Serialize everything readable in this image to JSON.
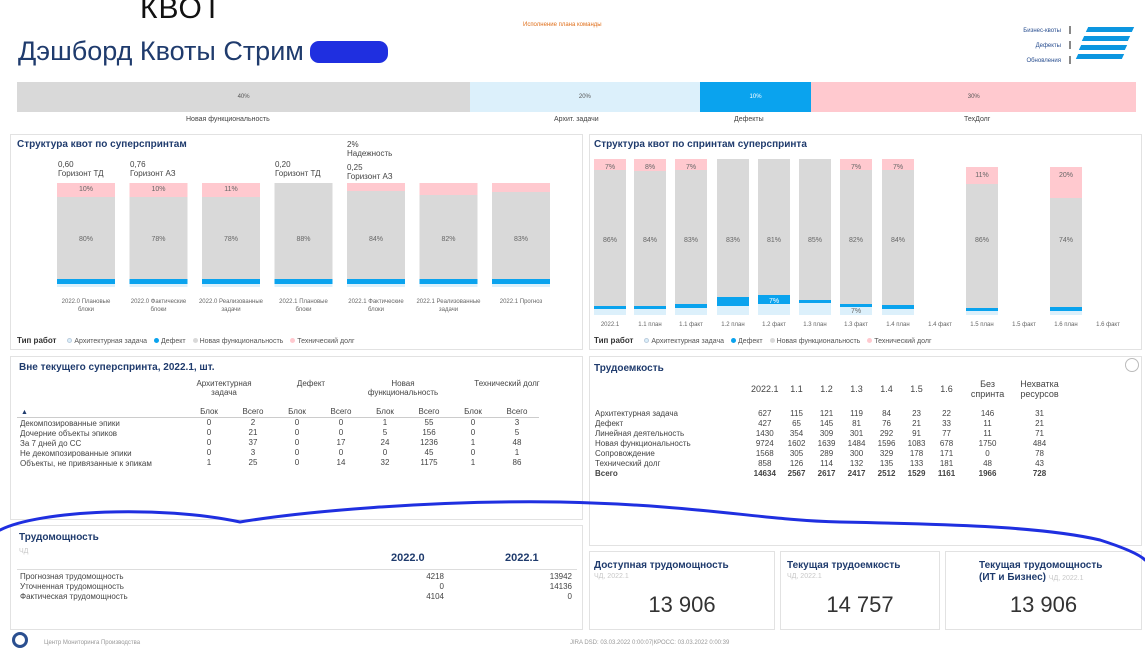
{
  "header": {
    "cut_text": "КВОТ",
    "title": "Дэшборд Квоты Стрим",
    "banner_note": "Исполнение плана команды",
    "links": [
      "Бизнес-квоты",
      "Дефекты",
      "Обновления"
    ]
  },
  "quota_bar": {
    "segments": [
      {
        "label": "Новая функциональность",
        "value": "40%",
        "color": "#d9d9d9",
        "flex": 40.5
      },
      {
        "label": "Архит. задачи",
        "value": "20%",
        "color": "#dcf0fb",
        "flex": 20.5
      },
      {
        "label": "Дефекты",
        "value": "10%",
        "color": "#0aa3ee",
        "flex": 10
      },
      {
        "label": "ТехДолг",
        "value": "30%",
        "color": "#ffc9cf",
        "flex": 29
      }
    ]
  },
  "superspring_chart": {
    "title": "Структура квот по суперспринтам",
    "annotations": [
      {
        "text": "0,60",
        "text2": "Горизонт ТД"
      },
      {
        "text": "0,76",
        "text2": "Горизонт АЗ"
      },
      {
        "text": "0,20",
        "text2": "Горизонт ТД"
      },
      {
        "text": "2%",
        "text2": "Надежность"
      },
      {
        "text": "0,25",
        "text2": "Горизонт АЗ"
      }
    ],
    "legend_title": "Тип работ",
    "legend": [
      {
        "name": "Архитектурная задача",
        "color": "#dcf0fb"
      },
      {
        "name": "Дефект",
        "color": "#0aa3ee"
      },
      {
        "name": "Новая функциональность",
        "color": "#d9d9d9"
      },
      {
        "name": "Технический долг",
        "color": "#ffc9cf"
      }
    ]
  },
  "sprint_chart": {
    "title": "Структура квот по спринтам суперспринта",
    "legend_title": "Тип работ"
  },
  "chart_data": [
    {
      "type": "bar",
      "title": "Структура квот по суперспринтам",
      "stacked": "100%",
      "categories": [
        "2022.0 Плановые блоки",
        "2022.0 Фактические блоки",
        "2022.0 Реализованные задачи",
        "2022.1 Плановые блоки",
        "2022.1 Фактические блоки",
        "2022.1 Реализованные задачи",
        "2022.1 Прогноз"
      ],
      "series": [
        {
          "name": "Новая функциональность",
          "values": [
            80,
            78,
            78,
            88,
            84,
            82,
            83
          ],
          "labels": [
            "80%",
            "78%",
            "78%",
            "88%",
            "84%",
            "82%",
            "83%"
          ]
        },
        {
          "name": "Технический долг",
          "values": [
            10,
            10,
            11,
            0,
            0,
            0,
            0
          ],
          "labels": [
            "10%",
            "10%",
            "11%",
            "",
            "",
            "",
            ""
          ]
        },
        {
          "name": "Дефект",
          "values": [
            3,
            3,
            2,
            2,
            2,
            2,
            2
          ]
        },
        {
          "name": "Архитектурная задача",
          "values": [
            7,
            9,
            9,
            10,
            14,
            16,
            15
          ]
        }
      ],
      "tp_heights": [
        14,
        14,
        14,
        0,
        8,
        12,
        9
      ]
    },
    {
      "type": "bar",
      "title": "Структура квот по спринтам суперспринта",
      "stacked": "100%",
      "categories": [
        "2022.1",
        "1.1 план",
        "1.1 факт",
        "1.2 план",
        "1.2 факт",
        "1.3 план",
        "1.3 факт",
        "1.4 план",
        "1.4 факт",
        "1.5 план",
        "1.5 факт",
        "1.6 план",
        "1.6 факт"
      ],
      "series": [
        {
          "name": "Технический долг",
          "values": [
            7,
            8,
            7,
            0,
            0,
            0,
            7,
            7,
            0,
            11,
            0,
            20,
            0
          ],
          "labels": [
            "7%",
            "8%",
            "7%",
            "",
            "",
            "",
            "7%",
            "7%",
            "",
            "11%",
            "",
            "20%",
            ""
          ]
        },
        {
          "name": "Новая функциональность",
          "values": [
            86,
            84,
            83,
            83,
            81,
            85,
            82,
            84,
            0,
            86,
            0,
            74,
            0
          ],
          "labels": [
            "86%",
            "84%",
            "83%",
            "83%",
            "81%",
            "85%",
            "82%",
            "84%",
            "",
            "86%",
            "",
            "74%",
            ""
          ]
        },
        {
          "name": "Дефект",
          "values": [
            1,
            2,
            3,
            7,
            7,
            2,
            2,
            3,
            0,
            2,
            0,
            3,
            0
          ],
          "labels": [
            "",
            "",
            "",
            "",
            "7%",
            "",
            "",
            "",
            "",
            "",
            "",
            "",
            ""
          ]
        },
        {
          "name": "Архитектурная задача",
          "values": [
            6,
            6,
            7,
            10,
            12,
            13,
            9,
            6,
            0,
            1,
            0,
            3,
            0
          ],
          "labels": [
            "",
            "",
            "",
            "",
            "",
            "",
            "7%",
            "",
            "",
            "",
            "",
            "",
            ""
          ]
        }
      ]
    }
  ],
  "out_table": {
    "title": "Вне текущего суперспринта, 2022.1, шт.",
    "groups": [
      "Архитектурная задача",
      "Дефект",
      "Новая функциональность",
      "Технический долг"
    ],
    "sub": [
      "Блок",
      "Всего"
    ],
    "rows": [
      {
        "label": "Декомпозированные эпики",
        "cells": [
          "0",
          "2",
          "0",
          "0",
          "1",
          "55",
          "0",
          "3"
        ]
      },
      {
        "label": "Дочерние объекты эпиков",
        "cells": [
          "0",
          "21",
          "0",
          "0",
          "5",
          "156",
          "0",
          "5"
        ]
      },
      {
        "label": "За 7 дней до СС",
        "cells": [
          "0",
          "37",
          "0",
          "17",
          "24",
          "1236",
          "1",
          "48"
        ]
      },
      {
        "label": "Не декомпозированные эпики",
        "cells": [
          "0",
          "3",
          "0",
          "0",
          "0",
          "45",
          "0",
          "1"
        ]
      },
      {
        "label": "Объекты, не привязанные к эпикам",
        "cells": [
          "1",
          "25",
          "0",
          "14",
          "32",
          "1175",
          "1",
          "86"
        ]
      }
    ]
  },
  "labor_table": {
    "title": "Трудоемкость",
    "headers": [
      "2022.1",
      "1.1",
      "1.2",
      "1.3",
      "1.4",
      "1.5",
      "1.6",
      "Без спринта",
      "Нехватка ресурсов"
    ],
    "rows": [
      {
        "label": "Архитектурная задача",
        "cells": [
          "627",
          "115",
          "121",
          "119",
          "84",
          "23",
          "22",
          "146",
          "31"
        ]
      },
      {
        "label": "Дефект",
        "cells": [
          "427",
          "65",
          "145",
          "81",
          "76",
          "21",
          "33",
          "11",
          "21"
        ]
      },
      {
        "label": "Линейная деятельность",
        "cells": [
          "1430",
          "354",
          "309",
          "301",
          "292",
          "91",
          "77",
          "11",
          "71"
        ]
      },
      {
        "label": "Новая функциональность",
        "cells": [
          "9724",
          "1602",
          "1639",
          "1484",
          "1596",
          "1083",
          "678",
          "1750",
          "484"
        ]
      },
      {
        "label": "Сопровождение",
        "cells": [
          "1568",
          "305",
          "289",
          "300",
          "329",
          "178",
          "171",
          "0",
          "78"
        ]
      },
      {
        "label": "Технический долг",
        "cells": [
          "858",
          "126",
          "114",
          "132",
          "135",
          "133",
          "181",
          "48",
          "43"
        ]
      }
    ],
    "total": {
      "label": "Всего",
      "cells": [
        "14634",
        "2567",
        "2617",
        "2417",
        "2512",
        "1529",
        "1161",
        "1966",
        "728"
      ]
    }
  },
  "capacity_table": {
    "title": "Трудомощность",
    "unit": "ЧД",
    "headers": [
      "2022.0",
      "2022.1"
    ],
    "rows": [
      {
        "label": "Прогнозная трудомощность",
        "cells": [
          "4218",
          "13942"
        ]
      },
      {
        "label": "Уточненная трудомощность",
        "cells": [
          "0",
          "14136"
        ]
      },
      {
        "label": "Фактическая трудомощность",
        "cells": [
          "4104",
          "0"
        ]
      }
    ]
  },
  "kpis": [
    {
      "title": "Доступная трудомощность",
      "title2": "",
      "sub": "ЧД, 2022.1",
      "value": "13 906"
    },
    {
      "title": "Текущая трудоемкость",
      "title2": "",
      "sub": "ЧД, 2022.1",
      "value": "14 757"
    },
    {
      "title": "Текущая трудомощность",
      "title2": "(ИТ и Бизнес)",
      "sub": "ЧД, 2022.1",
      "value": "13 906"
    }
  ],
  "footer": {
    "org": "Центр Мониторинга Производства",
    "timestamp": "JIRA DSD: 03.03.2022 0:00:07|КРОСС: 03.03.2022 0:00:39"
  },
  "colors": {
    "nf": "#d9d9d9",
    "tp": "#ffc9cf",
    "def": "#0aa3ee",
    "arch": "#dcf0fb",
    "title": "#1f3b6d",
    "ink": "#1f2fe0"
  }
}
